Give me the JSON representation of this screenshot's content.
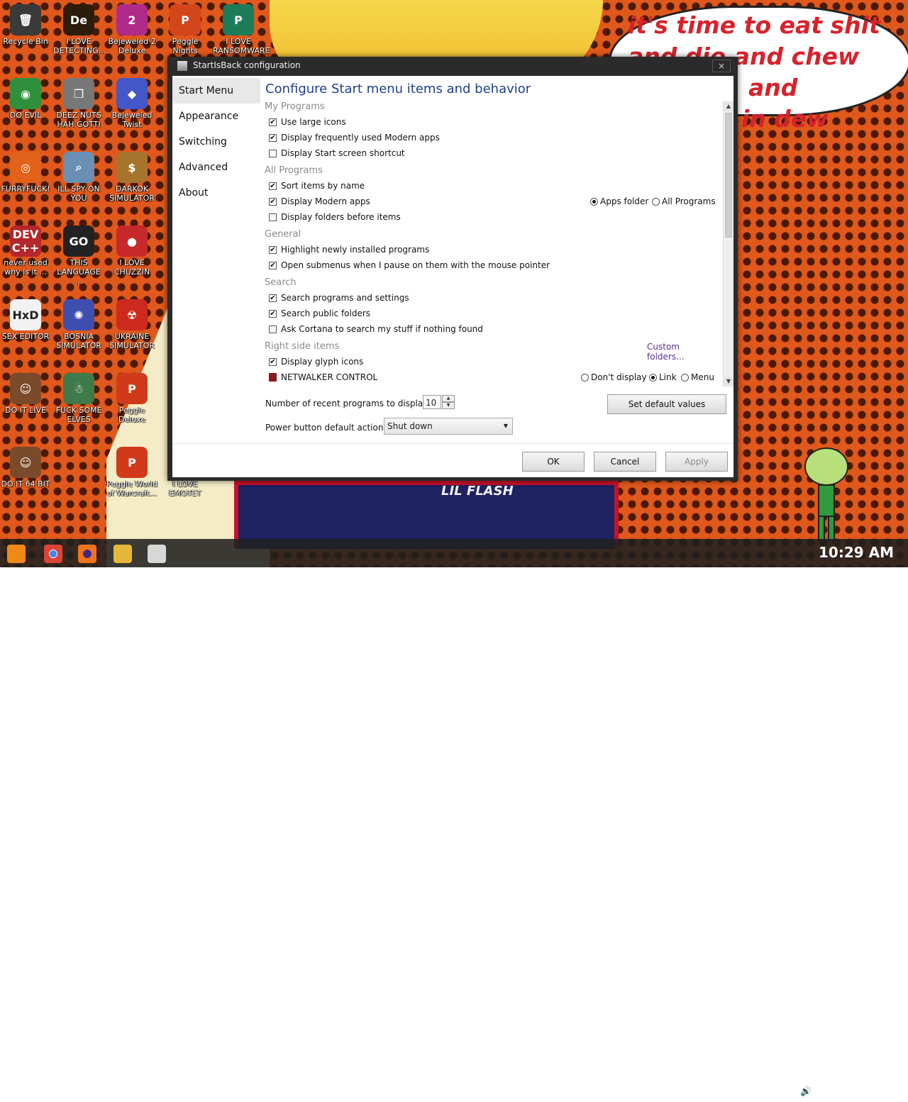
{
  "wallpaper": {
    "speech_lines": [
      "it's time to eat shit",
      "and die and chew",
      "and",
      "in dew"
    ],
    "poster_caption": "LIL FLASH"
  },
  "desktop_icons": [
    {
      "label": "Recycle Bin",
      "glyph": "🗑",
      "color": "#3a3a3a"
    },
    {
      "label": "I LOVE DETECTING...",
      "glyph": "De",
      "color": "#2b1d0a"
    },
    {
      "label": "Bejeweled 2 Deluxe",
      "glyph": "2",
      "color": "#b02a8a"
    },
    {
      "label": "Peggle Nights Deluxe",
      "glyph": "P",
      "color": "#d3451a"
    },
    {
      "label": "I LOVE RANSOMWARE",
      "glyph": "P",
      "color": "#1d7d5a"
    },
    {
      "label": "DO EVIL",
      "glyph": "◉",
      "color": "#2f8f3a"
    },
    {
      "label": "DEEZ NUTS HAH GOTTI",
      "glyph": "❐",
      "color": "#777"
    },
    {
      "label": "Bejeweled Twist",
      "glyph": "◆",
      "color": "#4357c9"
    },
    {
      "label": "FURRYFUCK!",
      "glyph": "◎",
      "color": "#e2621b"
    },
    {
      "label": "ILL SPY ON YOU",
      "glyph": "⌕",
      "color": "#6a8fb5"
    },
    {
      "label": "DARKOK SIMULATOR",
      "glyph": "$",
      "color": "#a6742c"
    },
    {
      "label": "never used why is it ...",
      "glyph": "DEV C++",
      "color": "#b4262a"
    },
    {
      "label": "THIS LANGUAGE ...",
      "glyph": "GO",
      "color": "#222"
    },
    {
      "label": "I LOVE CHUZZIN",
      "glyph": "●",
      "color": "#c7282a"
    },
    {
      "label": "SEX EDITOR",
      "glyph": "HxD",
      "color": "#f2f2f2"
    },
    {
      "label": "BOSNIA SIMULATOR",
      "glyph": "✺",
      "color": "#3f4fb0"
    },
    {
      "label": "UKRAINE SIMULATOR",
      "glyph": "☢",
      "color": "#cc2a1e"
    },
    {
      "label": "DO IT LIVE",
      "glyph": "☺",
      "color": "#7a4a2a"
    },
    {
      "label": "FUCK SOME ELVES",
      "glyph": "☃",
      "color": "#3f7a4a"
    },
    {
      "label": "Peggle Deluxe",
      "glyph": "P",
      "color": "#d03a1a"
    },
    {
      "label": "DO IT 64 BIT",
      "glyph": "☺",
      "color": "#7a4a2a"
    },
    {
      "label": "Peggle World of Warcraft...",
      "glyph": "P",
      "color": "#d03a1a"
    },
    {
      "label": "I LOVE EMOTET",
      "glyph": "",
      "color": "#f4ecc6"
    }
  ],
  "dialog": {
    "title": "StartIsBack configuration",
    "close_glyph": "×",
    "nav": [
      "Start Menu",
      "Appearance",
      "Switching",
      "Advanced",
      "About"
    ],
    "active_nav": "Start Menu",
    "heading": "Configure Start menu items and behavior",
    "sections": {
      "my_programs": {
        "title": "My Programs",
        "options": [
          {
            "label": "Use large icons",
            "checked": true
          },
          {
            "label": "Display frequently used Modern apps",
            "checked": true
          },
          {
            "label": "Display Start screen shortcut",
            "checked": false
          }
        ]
      },
      "all_programs": {
        "title": "All Programs",
        "options": [
          {
            "label": "Sort items by name",
            "checked": true
          },
          {
            "label": "Display Modern apps",
            "checked": true
          },
          {
            "label": "Display folders before items",
            "checked": false
          }
        ],
        "modern_apps_radios": [
          {
            "label": "Apps folder",
            "selected": true
          },
          {
            "label": "All Programs",
            "selected": false
          }
        ]
      },
      "general": {
        "title": "General",
        "options": [
          {
            "label": "Highlight newly installed programs",
            "checked": true
          },
          {
            "label": "Open submenus when I pause on them with the mouse pointer",
            "checked": true
          }
        ]
      },
      "search": {
        "title": "Search",
        "options": [
          {
            "label": "Search programs and settings",
            "checked": true
          },
          {
            "label": "Search public folders",
            "checked": true
          },
          {
            "label": "Ask Cortana to search my stuff if nothing found",
            "checked": false
          }
        ]
      },
      "right_side": {
        "title": "Right side items",
        "custom_link": "Custom folders...",
        "options": [
          {
            "label": "Display glyph icons",
            "checked": true
          }
        ],
        "item_label": "NETWALKER CONTROL",
        "item_radios": [
          {
            "label": "Don't display",
            "selected": false
          },
          {
            "label": "Link",
            "selected": true
          },
          {
            "label": "Menu",
            "selected": false
          }
        ]
      }
    },
    "recent_label": "Number of recent programs to display:",
    "recent_value": "10",
    "set_default_label": "Set default values",
    "power_label": "Power button default action:",
    "power_value": "Shut down",
    "ok_label": "OK",
    "cancel_label": "Cancel",
    "apply_label": "Apply"
  },
  "taskbar": {
    "clock": "10:29 AM"
  }
}
